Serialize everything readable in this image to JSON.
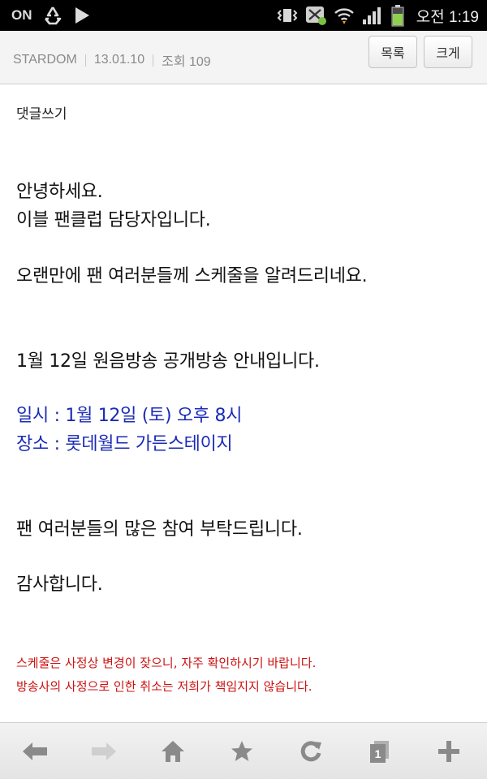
{
  "status_bar": {
    "carrier_text": "ON",
    "time": "오전 1:19",
    "icons": [
      "recycle-icon",
      "play-icon",
      "vibrate-icon",
      "sync-icon",
      "wifi-icon",
      "signal-icon",
      "battery-icon"
    ]
  },
  "header": {
    "board": "STARDOM",
    "date": "13.01.10",
    "views": "조회 109",
    "list_button": "목록",
    "enlarge_button": "크게"
  },
  "article": {
    "comment_link": "댓글쓰기",
    "lines": [
      "안녕하세요.",
      "이블 팬클럽 담당자입니다.",
      "오랜만에 팬 여러분들께 스케줄을 알려드리네요.",
      "1월 12일 원음방송 공개방송 안내입니다.",
      "일시 : 1월 12일 (토) 오후 8시",
      "장소 : 롯데월드 가든스테이지",
      "팬 여러분들의 많은 참여 부탁드립니다.",
      "감사합니다."
    ],
    "notices": [
      "스케줄은 사정상 변경이 잦으니, 자주 확인하시기 바랍니다.",
      "방송사의 사정으로 인한 취소는 저희가 책임지지 않습니다."
    ]
  },
  "toolbar": {
    "buttons": [
      "back-icon",
      "forward-icon",
      "home-icon",
      "bookmark-star-icon",
      "refresh-icon",
      "windows-icon",
      "add-icon"
    ],
    "window_count": "1"
  },
  "colors": {
    "highlight_text": "#1a2bb5",
    "notice_text": "#cc1111",
    "status_bar_bg": "#000000"
  }
}
